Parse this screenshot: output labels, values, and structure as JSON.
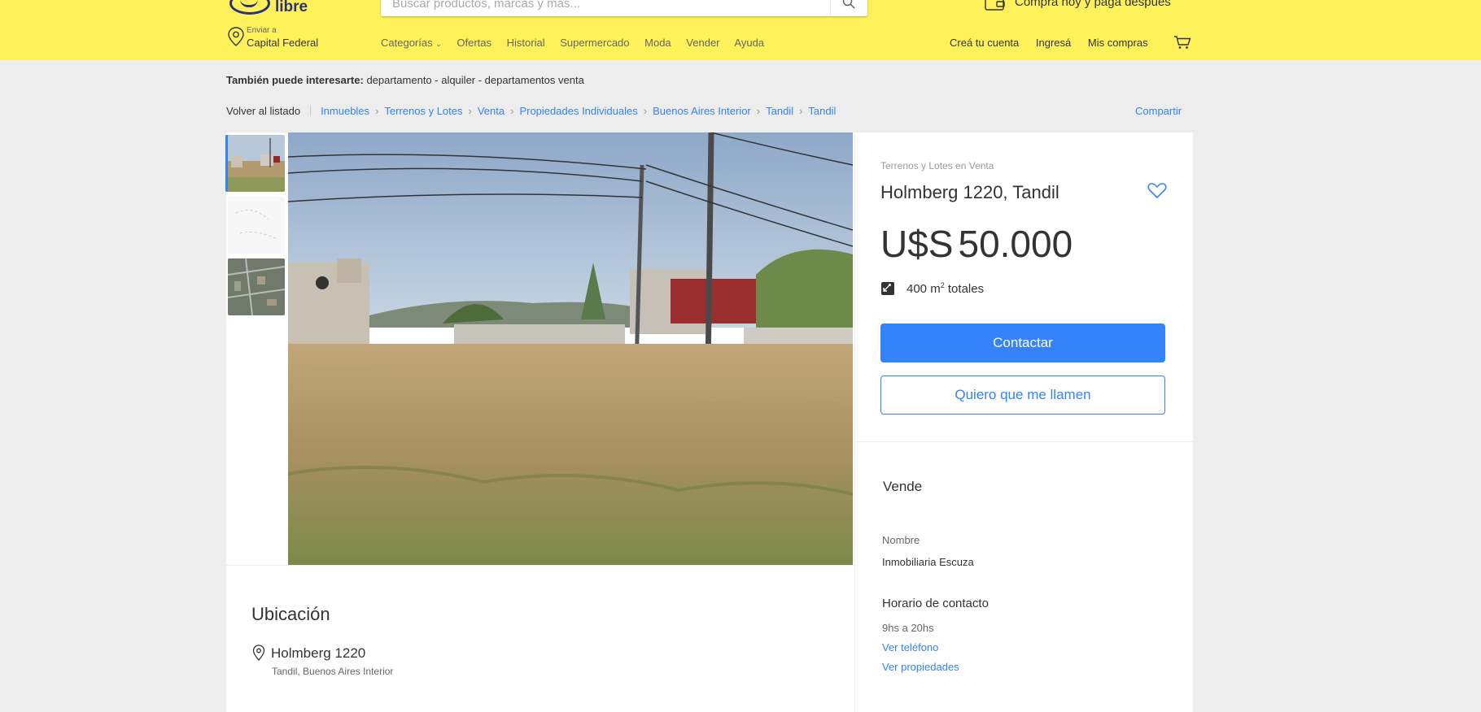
{
  "header": {
    "logo_text": "libre",
    "search_placeholder": "Buscar productos, marcas y más...",
    "promo": "Comprá hoy y pagá después",
    "ship_label": "Enviar a",
    "ship_location": "Capital Federal",
    "nav": [
      "Categorías",
      "Ofertas",
      "Historial",
      "Supermercado",
      "Moda",
      "Vender",
      "Ayuda"
    ],
    "account": [
      "Creá tu cuenta",
      "Ingresá",
      "Mis compras"
    ]
  },
  "suggest": {
    "label": "También puede interesarte:",
    "items": "departamento - alquiler - departamentos venta"
  },
  "breadcrumb": {
    "back": "Volver al listado",
    "items": [
      "Inmuebles",
      "Terrenos y Lotes",
      "Venta",
      "Propiedades Individuales",
      "Buenos Aires Interior",
      "Tandil",
      "Tandil"
    ],
    "share": "Compartir"
  },
  "listing": {
    "subtitle": "Terrenos y Lotes en Venta",
    "title": "Holmberg 1220, Tandil",
    "currency": "U$S",
    "price": "50.000",
    "area_value": "400 m",
    "area_sup": "2",
    "area_label": "totales",
    "contact_button": "Contactar",
    "call_button": "Quiero que me llamen"
  },
  "location": {
    "title": "Ubicación",
    "address": "Holmberg 1220",
    "region": "Tandil, Buenos Aires Interior"
  },
  "seller": {
    "title": "Vende",
    "name_label": "Nombre",
    "name": "Inmobiliaria Escuza",
    "hours_label": "Horario de contacto",
    "hours": "9hs a 20hs",
    "phone_link": "Ver teléfono",
    "properties_link": "Ver propiedades"
  },
  "colors": {
    "header_bg": "#fff159",
    "accent": "#3483fa"
  }
}
